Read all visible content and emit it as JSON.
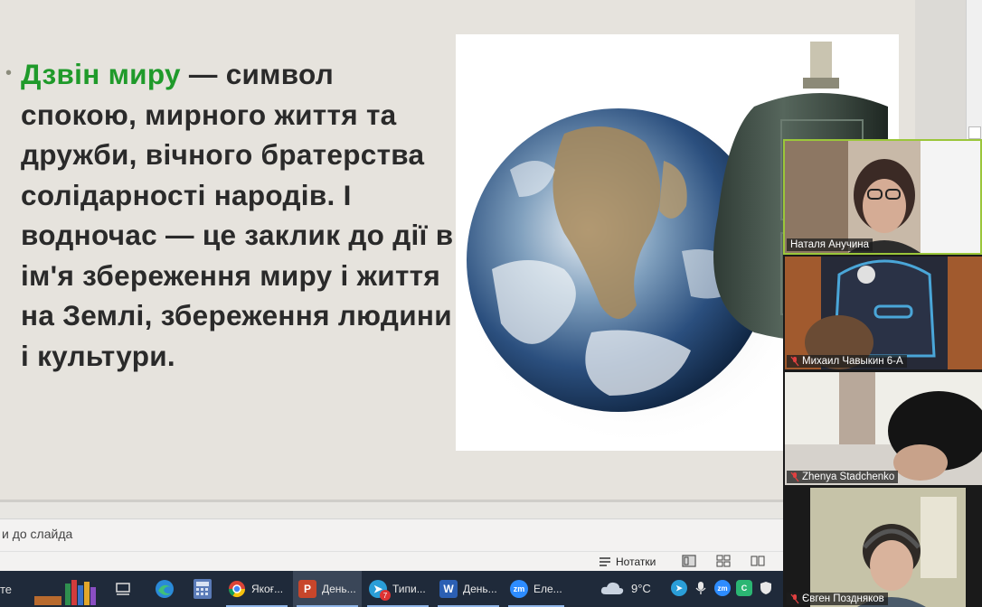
{
  "slide": {
    "bullet_highlight": "Дзвін миру",
    "bullet_text": " — символ спокою, мирного життя та дружби, вічного братерства солідарності народів. І водночас — це заклик до дії в ім'я збереження миру і життя на Землі, збереження людини і культури."
  },
  "notes": {
    "placeholder": "и до слайда"
  },
  "status_bar": {
    "notes_label": "Нотатки"
  },
  "taskbar": {
    "left_partial": "те",
    "apps": [
      {
        "label": "Якоғ...",
        "icon": "chrome-icon"
      },
      {
        "label": "День...",
        "icon": "powerpoint-icon",
        "active": true
      },
      {
        "label": "Типи...",
        "icon": "telegram-icon",
        "badge": "7"
      },
      {
        "label": "День...",
        "icon": "word-icon"
      },
      {
        "label": "Еле...",
        "icon": "zoom-icon"
      }
    ],
    "weather": "9°C"
  },
  "zoom": {
    "participants": [
      {
        "name": "Наталя Анучина",
        "muted": false,
        "active_speaker": true
      },
      {
        "name": "Михаил Чавыкин 6-А",
        "muted": true
      },
      {
        "name": "Zhenya Stadchenko",
        "muted": true
      },
      {
        "name": "Євген Поздняков",
        "muted": true
      }
    ]
  },
  "colors": {
    "highlight_green": "#1f9a2a",
    "taskbar_bg": "#1f2a3a",
    "active_speaker_border": "#9bc63a"
  }
}
